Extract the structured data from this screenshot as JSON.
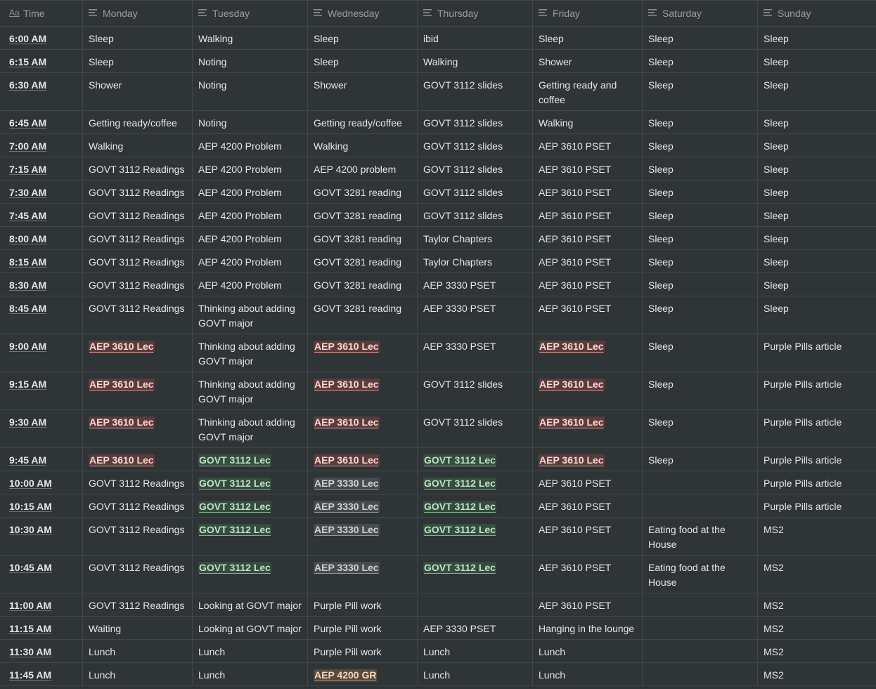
{
  "columns": [
    {
      "label": "Time",
      "icon": "title-aa-icon"
    },
    {
      "label": "Monday",
      "icon": "text-lines-icon"
    },
    {
      "label": "Tuesday",
      "icon": "text-lines-icon"
    },
    {
      "label": "Wednesday",
      "icon": "text-lines-icon"
    },
    {
      "label": "Thursday",
      "icon": "text-lines-icon"
    },
    {
      "label": "Friday",
      "icon": "text-lines-icon"
    },
    {
      "label": "Saturday",
      "icon": "text-lines-icon"
    },
    {
      "label": "Sunday",
      "icon": "text-lines-icon"
    }
  ],
  "tag_colors": {
    "red": "#5c3b3b",
    "green": "#354c3f",
    "gray": "#454b4e",
    "brown": "#5a4a3d"
  },
  "rows": [
    {
      "time": "6:00 AM",
      "cells": [
        {
          "text": "Sleep"
        },
        {
          "text": "Walking"
        },
        {
          "text": "Sleep"
        },
        {
          "text": "ibid"
        },
        {
          "text": "Sleep"
        },
        {
          "text": "Sleep"
        },
        {
          "text": "Sleep"
        }
      ]
    },
    {
      "time": "6:15 AM",
      "cells": [
        {
          "text": "Sleep"
        },
        {
          "text": "Noting"
        },
        {
          "text": "Sleep"
        },
        {
          "text": "Walking"
        },
        {
          "text": "Shower"
        },
        {
          "text": "Sleep"
        },
        {
          "text": "Sleep"
        }
      ]
    },
    {
      "time": "6:30 AM",
      "tall": true,
      "cells": [
        {
          "text": "Shower"
        },
        {
          "text": "Noting"
        },
        {
          "text": "Shower"
        },
        {
          "text": "GOVT 3112 slides"
        },
        {
          "text": "Getting ready and coffee"
        },
        {
          "text": "Sleep"
        },
        {
          "text": "Sleep"
        }
      ]
    },
    {
      "time": "6:45 AM",
      "cells": [
        {
          "text": "Getting ready/coffee"
        },
        {
          "text": "Noting"
        },
        {
          "text": "Getting ready/coffee"
        },
        {
          "text": "GOVT 3112 slides"
        },
        {
          "text": "Walking"
        },
        {
          "text": "Sleep"
        },
        {
          "text": "Sleep"
        }
      ]
    },
    {
      "time": "7:00 AM",
      "cells": [
        {
          "text": "Walking"
        },
        {
          "text": "AEP 4200 Problem"
        },
        {
          "text": "Walking"
        },
        {
          "text": "GOVT 3112 slides"
        },
        {
          "text": "AEP 3610 PSET"
        },
        {
          "text": "Sleep"
        },
        {
          "text": "Sleep"
        }
      ]
    },
    {
      "time": "7:15 AM",
      "cells": [
        {
          "text": "GOVT 3112 Readings"
        },
        {
          "text": "AEP 4200 Problem"
        },
        {
          "text": "AEP 4200 problem"
        },
        {
          "text": "GOVT 3112 slides"
        },
        {
          "text": "AEP 3610 PSET"
        },
        {
          "text": "Sleep"
        },
        {
          "text": "Sleep"
        }
      ]
    },
    {
      "time": "7:30 AM",
      "cells": [
        {
          "text": "GOVT 3112 Readings"
        },
        {
          "text": "AEP 4200 Problem"
        },
        {
          "text": "GOVT 3281 reading"
        },
        {
          "text": "GOVT 3112 slides"
        },
        {
          "text": "AEP 3610 PSET"
        },
        {
          "text": "Sleep"
        },
        {
          "text": "Sleep"
        }
      ]
    },
    {
      "time": "7:45 AM",
      "cells": [
        {
          "text": "GOVT 3112 Readings"
        },
        {
          "text": "AEP 4200 Problem"
        },
        {
          "text": "GOVT 3281 reading"
        },
        {
          "text": "GOVT 3112 slides"
        },
        {
          "text": "AEP 3610 PSET"
        },
        {
          "text": "Sleep"
        },
        {
          "text": "Sleep"
        }
      ]
    },
    {
      "time": "8:00 AM",
      "cells": [
        {
          "text": "GOVT 3112 Readings"
        },
        {
          "text": "AEP 4200 Problem"
        },
        {
          "text": "GOVT 3281 reading"
        },
        {
          "text": "Taylor Chapters"
        },
        {
          "text": "AEP 3610 PSET"
        },
        {
          "text": "Sleep"
        },
        {
          "text": "Sleep"
        }
      ]
    },
    {
      "time": "8:15 AM",
      "cells": [
        {
          "text": "GOVT 3112 Readings"
        },
        {
          "text": "AEP 4200 Problem"
        },
        {
          "text": "GOVT 3281 reading"
        },
        {
          "text": "Taylor Chapters"
        },
        {
          "text": "AEP 3610 PSET"
        },
        {
          "text": "Sleep"
        },
        {
          "text": "Sleep"
        }
      ]
    },
    {
      "time": "8:30 AM",
      "cells": [
        {
          "text": "GOVT 3112 Readings"
        },
        {
          "text": "AEP 4200 Problem"
        },
        {
          "text": "GOVT 3281 reading"
        },
        {
          "text": "AEP 3330 PSET"
        },
        {
          "text": "AEP 3610 PSET"
        },
        {
          "text": "Sleep"
        },
        {
          "text": "Sleep"
        }
      ]
    },
    {
      "time": "8:45 AM",
      "tall": true,
      "cells": [
        {
          "text": "GOVT 3112 Readings"
        },
        {
          "text": "Thinking about adding GOVT major"
        },
        {
          "text": "GOVT 3281 reading"
        },
        {
          "text": "AEP 3330 PSET"
        },
        {
          "text": "AEP 3610 PSET"
        },
        {
          "text": "Sleep"
        },
        {
          "text": "Sleep"
        }
      ]
    },
    {
      "time": "9:00 AM",
      "tall": true,
      "cells": [
        {
          "text": "AEP 3610 Lec",
          "tag": "red"
        },
        {
          "text": "Thinking about adding GOVT major"
        },
        {
          "text": "AEP 3610 Lec",
          "tag": "red"
        },
        {
          "text": "AEP 3330 PSET"
        },
        {
          "text": "AEP 3610 Lec",
          "tag": "red"
        },
        {
          "text": "Sleep"
        },
        {
          "text": "Purple Pills article"
        }
      ]
    },
    {
      "time": "9:15 AM",
      "tall": true,
      "cells": [
        {
          "text": "AEP 3610 Lec",
          "tag": "red"
        },
        {
          "text": "Thinking about adding GOVT major"
        },
        {
          "text": "AEP 3610 Lec",
          "tag": "red"
        },
        {
          "text": "GOVT 3112 slides"
        },
        {
          "text": "AEP 3610 Lec",
          "tag": "red"
        },
        {
          "text": "Sleep"
        },
        {
          "text": "Purple Pills article"
        }
      ]
    },
    {
      "time": "9:30 AM",
      "tall": true,
      "cells": [
        {
          "text": "AEP 3610 Lec",
          "tag": "red"
        },
        {
          "text": "Thinking about adding GOVT major"
        },
        {
          "text": "AEP 3610 Lec",
          "tag": "red"
        },
        {
          "text": "GOVT 3112 slides"
        },
        {
          "text": "AEP 3610 Lec",
          "tag": "red"
        },
        {
          "text": "Sleep"
        },
        {
          "text": "Purple Pills article"
        }
      ]
    },
    {
      "time": "9:45 AM",
      "cells": [
        {
          "text": "AEP 3610 Lec",
          "tag": "red"
        },
        {
          "text": "GOVT 3112 Lec",
          "tag": "green"
        },
        {
          "text": "AEP 3610 Lec",
          "tag": "red"
        },
        {
          "text": "GOVT 3112 Lec",
          "tag": "green"
        },
        {
          "text": "AEP 3610 Lec",
          "tag": "red"
        },
        {
          "text": "Sleep"
        },
        {
          "text": "Purple Pills article"
        }
      ]
    },
    {
      "time": "10:00 AM",
      "cells": [
        {
          "text": "GOVT 3112 Readings"
        },
        {
          "text": "GOVT 3112 Lec",
          "tag": "green"
        },
        {
          "text": "AEP 3330 Lec",
          "tag": "gray"
        },
        {
          "text": "GOVT 3112 Lec",
          "tag": "green"
        },
        {
          "text": "AEP 3610 PSET"
        },
        {
          "text": ""
        },
        {
          "text": "Purple Pills article"
        }
      ]
    },
    {
      "time": "10:15 AM",
      "cells": [
        {
          "text": "GOVT 3112 Readings"
        },
        {
          "text": "GOVT 3112 Lec",
          "tag": "green"
        },
        {
          "text": "AEP 3330 Lec",
          "tag": "gray"
        },
        {
          "text": "GOVT 3112 Lec",
          "tag": "green"
        },
        {
          "text": "AEP 3610 PSET"
        },
        {
          "text": ""
        },
        {
          "text": "Purple Pills article"
        }
      ]
    },
    {
      "time": "10:30 AM",
      "tall": true,
      "cells": [
        {
          "text": "GOVT 3112 Readings"
        },
        {
          "text": "GOVT 3112 Lec",
          "tag": "green"
        },
        {
          "text": "AEP 3330 Lec",
          "tag": "gray"
        },
        {
          "text": "GOVT 3112 Lec",
          "tag": "green"
        },
        {
          "text": "AEP 3610 PSET"
        },
        {
          "text": "Eating food at the House"
        },
        {
          "text": "MS2"
        }
      ]
    },
    {
      "time": "10:45 AM",
      "tall": true,
      "cells": [
        {
          "text": "GOVT 3112 Readings"
        },
        {
          "text": "GOVT 3112 Lec",
          "tag": "green"
        },
        {
          "text": "AEP 3330 Lec",
          "tag": "gray"
        },
        {
          "text": "GOVT 3112 Lec",
          "tag": "green"
        },
        {
          "text": "AEP 3610 PSET"
        },
        {
          "text": "Eating food at the House"
        },
        {
          "text": "MS2"
        }
      ]
    },
    {
      "time": "11:00 AM",
      "cells": [
        {
          "text": "GOVT 3112 Readings"
        },
        {
          "text": "Looking at GOVT major"
        },
        {
          "text": "Purple Pill work"
        },
        {
          "text": ""
        },
        {
          "text": "AEP 3610 PSET"
        },
        {
          "text": ""
        },
        {
          "text": "MS2"
        }
      ]
    },
    {
      "time": "11:15 AM",
      "cells": [
        {
          "text": "Waiting"
        },
        {
          "text": "Looking at GOVT major"
        },
        {
          "text": "Purple Pill work"
        },
        {
          "text": "AEP 3330 PSET"
        },
        {
          "text": "Hanging in the lounge"
        },
        {
          "text": ""
        },
        {
          "text": "MS2"
        }
      ]
    },
    {
      "time": "11:30 AM",
      "cells": [
        {
          "text": "Lunch"
        },
        {
          "text": "Lunch"
        },
        {
          "text": "Purple Pill work"
        },
        {
          "text": "Lunch"
        },
        {
          "text": "Lunch"
        },
        {
          "text": ""
        },
        {
          "text": "MS2"
        }
      ]
    },
    {
      "time": "11:45 AM",
      "cells": [
        {
          "text": "Lunch"
        },
        {
          "text": "Lunch"
        },
        {
          "text": "AEP 4200 GR",
          "tag": "brown"
        },
        {
          "text": "Lunch"
        },
        {
          "text": "Lunch"
        },
        {
          "text": ""
        },
        {
          "text": "MS2"
        }
      ]
    }
  ]
}
